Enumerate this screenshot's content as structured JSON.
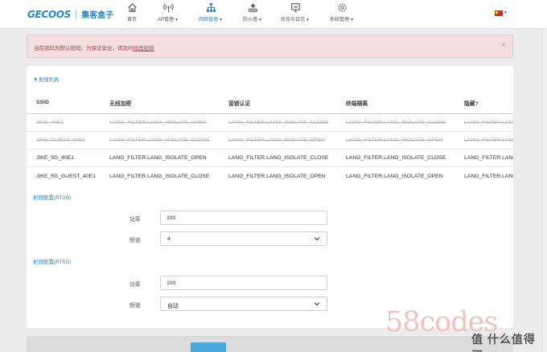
{
  "brand": {
    "name_en": "GECOOS",
    "name_cn": "集客盒子"
  },
  "nav": [
    {
      "label": "首页",
      "icon": "home-icon",
      "dropdown": false
    },
    {
      "label": "AP管理",
      "icon": "wifi-antenna-icon",
      "dropdown": true
    },
    {
      "label": "网络管理",
      "icon": "network-icon",
      "dropdown": true,
      "active": true
    },
    {
      "label": "防火墙",
      "icon": "firewall-icon",
      "dropdown": true
    },
    {
      "label": "状态与日志",
      "icon": "monitor-icon",
      "dropdown": true
    },
    {
      "label": "系统管理",
      "icon": "gear-icon",
      "dropdown": true
    }
  ],
  "alert": {
    "text": "当前密码为默认密码。为保证安全，请及时",
    "link": "修改密码",
    "close": "×"
  },
  "wifi_list": {
    "title": "▼无线列表",
    "columns": [
      "SSID",
      "无线加密",
      "营销认证",
      "终端隔离",
      "隐藏?"
    ],
    "rows": [
      {
        "struck": true,
        "cells": [
          "JIKE_40E1",
          "LANG_FILTER.LANG_ISOLATE_OPEN",
          "LANG_FILTER.LANG_ISOLATE_CLOSE",
          "LANG_FILTER.LANG_ISOLATE_CLOSE",
          "LANG_FILTER.LANG_FILTE"
        ]
      },
      {
        "struck": true,
        "cells": [
          "JIKE_GUEST_40E1",
          "LANG_FILTER.LANG_ISOLATE_CLOSE",
          "LANG_FILTER.LANG_ISOLATE_OPEN",
          "LANG_FILTER.LANG_ISOLATE_OPEN",
          "LANG_FILTER.LANG_FILTE"
        ]
      },
      {
        "struck": false,
        "cells": [
          "JIKE_5G_40E1",
          "LANG_FILTER.LANG_ISOLATE_OPEN",
          "LANG_FILTER.LANG_ISOLATE_CLOSE",
          "LANG_FILTER.LANG_ISOLATE_CLOSE",
          "LANG_FILTER.LANG_FILTE"
        ]
      },
      {
        "struck": false,
        "cells": [
          "JIKE_5G_GUEST_40E1",
          "LANG_FILTER.LANG_ISOLATE_CLOSE",
          "LANG_FILTER.LANG_ISOLATE_OPEN",
          "LANG_FILTER.LANG_ISOLATE_OPEN",
          "LANG_FILTER.LANG_FILTE"
        ]
      }
    ]
  },
  "radio_2g": {
    "title": "射频配置(RT2G)",
    "power_label": "功率",
    "power_value": "100",
    "channel_label": "频道",
    "channel_value": "4"
  },
  "radio_5g": {
    "title": "射频配置(RT5G)",
    "power_label": "功率",
    "power_value": "100",
    "channel_label": "频道",
    "channel_value": "自动"
  },
  "watermark": "58codes",
  "badge": "值 什么值得买",
  "colors": {
    "accent": "#2a88c6",
    "alert_bg": "#f4dede",
    "alert_text": "#a94442",
    "flag": "#d5271d"
  }
}
